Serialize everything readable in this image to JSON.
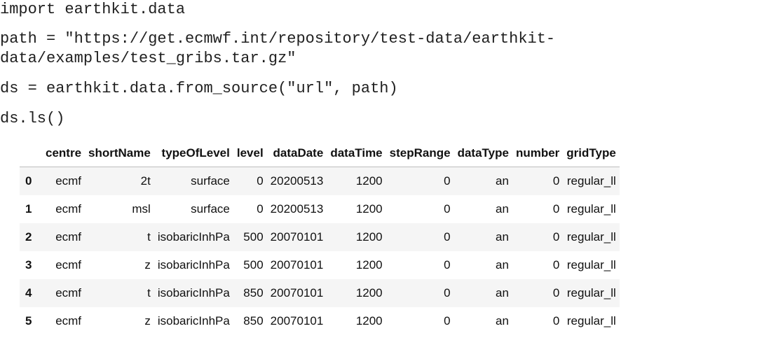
{
  "code_lines": [
    "import earthkit.data",
    "path = \"https://get.ecmwf.int/repository/test-data/earthkit-",
    "data/examples/test_gribs.tar.gz\"",
    "ds = earthkit.data.from_source(\"url\", path)",
    "ds.ls()"
  ],
  "table": {
    "columns": [
      "centre",
      "shortName",
      "typeOfLevel",
      "level",
      "dataDate",
      "dataTime",
      "stepRange",
      "dataType",
      "number",
      "gridType"
    ],
    "rows": [
      {
        "index": "0",
        "cells": [
          "ecmf",
          "2t",
          "surface",
          "0",
          "20200513",
          "1200",
          "0",
          "an",
          "0",
          "regular_ll"
        ]
      },
      {
        "index": "1",
        "cells": [
          "ecmf",
          "msl",
          "surface",
          "0",
          "20200513",
          "1200",
          "0",
          "an",
          "0",
          "regular_ll"
        ]
      },
      {
        "index": "2",
        "cells": [
          "ecmf",
          "t",
          "isobaricInhPa",
          "500",
          "20070101",
          "1200",
          "0",
          "an",
          "0",
          "regular_ll"
        ]
      },
      {
        "index": "3",
        "cells": [
          "ecmf",
          "z",
          "isobaricInhPa",
          "500",
          "20070101",
          "1200",
          "0",
          "an",
          "0",
          "regular_ll"
        ]
      },
      {
        "index": "4",
        "cells": [
          "ecmf",
          "t",
          "isobaricInhPa",
          "850",
          "20070101",
          "1200",
          "0",
          "an",
          "0",
          "regular_ll"
        ]
      },
      {
        "index": "5",
        "cells": [
          "ecmf",
          "z",
          "isobaricInhPa",
          "850",
          "20070101",
          "1200",
          "0",
          "an",
          "0",
          "regular_ll"
        ]
      }
    ]
  }
}
